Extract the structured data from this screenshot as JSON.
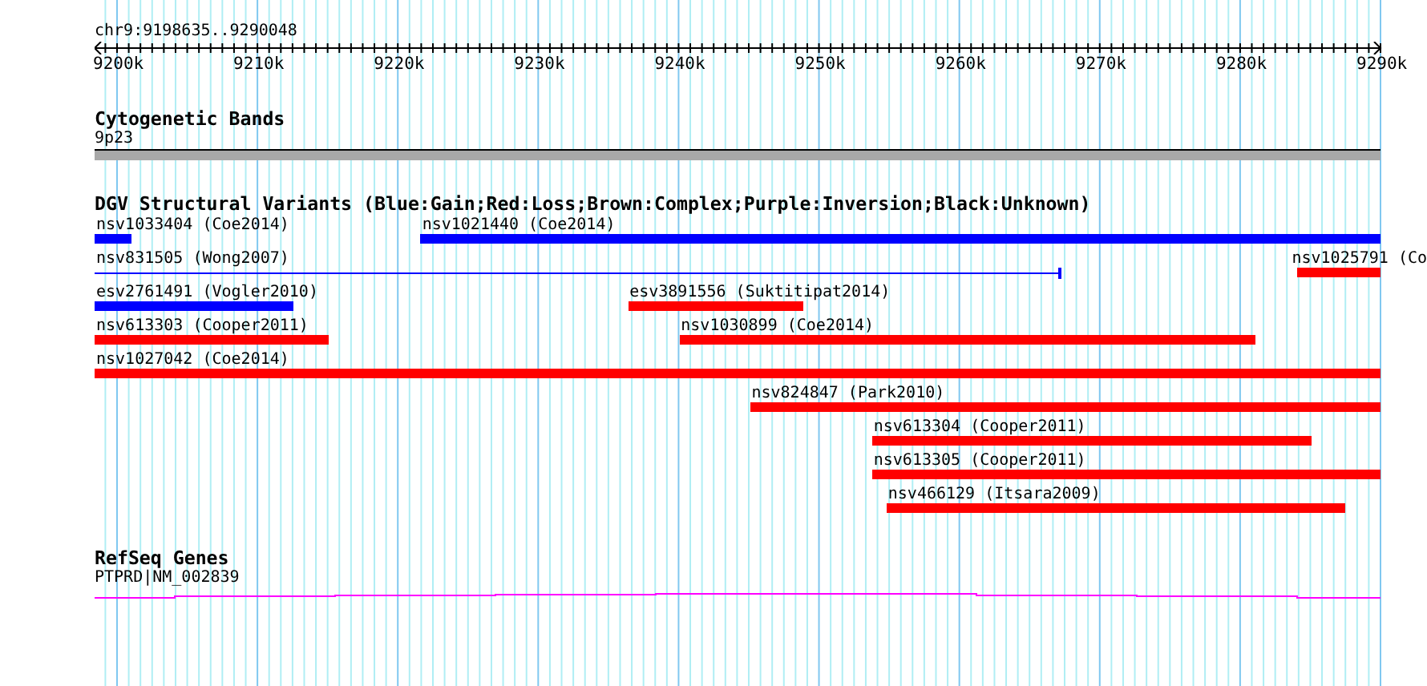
{
  "ruler": {
    "label": "chr9:9198635..9290048",
    "ticks": [
      "9200k",
      "9210k",
      "9220k",
      "9230k",
      "9240k",
      "9250k",
      "9260k",
      "9270k",
      "9280k",
      "9290k"
    ]
  },
  "cytogenetic_track": {
    "title": "Cytogenetic Bands",
    "band_label": "9p23"
  },
  "dgv_track": {
    "title": "DGV Structural Variants (Blue:Gain;Red:Loss;Brown:Complex;Purple:Inversion;Black:Unknown)",
    "rows": [
      {
        "features": [
          {
            "label": "nsv1033404 (Coe2014)",
            "kind": "bar",
            "color": "#0000ff"
          },
          {
            "label": "nsv1021440 (Coe2014)",
            "kind": "bar",
            "color": "#0000ff"
          }
        ]
      },
      {
        "features": [
          {
            "label": "nsv831505 (Wong2007)",
            "kind": "line",
            "color": "#0000ff"
          },
          {
            "label": "nsv1025791 (Co",
            "kind": "bar",
            "color": "#ff0000"
          }
        ]
      },
      {
        "features": [
          {
            "label": "esv2761491 (Vogler2010)",
            "kind": "bar",
            "color": "#0000ff"
          },
          {
            "label": "esv3891556 (Suktitipat2014)",
            "kind": "bar",
            "color": "#ff0000"
          }
        ]
      },
      {
        "features": [
          {
            "label": "nsv613303 (Cooper2011)",
            "kind": "bar",
            "color": "#ff0000"
          },
          {
            "label": "nsv1030899 (Coe2014)",
            "kind": "bar",
            "color": "#ff0000"
          }
        ]
      },
      {
        "features": [
          {
            "label": "nsv1027042 (Coe2014)",
            "kind": "bar",
            "color": "#ff0000"
          }
        ]
      },
      {
        "features": [
          {
            "label": "nsv824847 (Park2010)",
            "kind": "bar",
            "color": "#ff0000"
          }
        ]
      },
      {
        "features": [
          {
            "label": "nsv613304 (Cooper2011)",
            "kind": "bar",
            "color": "#ff0000"
          }
        ]
      },
      {
        "features": [
          {
            "label": "nsv613305 (Cooper2011)",
            "kind": "bar",
            "color": "#ff0000"
          }
        ]
      },
      {
        "features": [
          {
            "label": "nsv466129 (Itsara2009)",
            "kind": "bar",
            "color": "#ff0000"
          }
        ]
      }
    ]
  },
  "refseq_track": {
    "title": "RefSeq Genes",
    "gene_label": "PTPRD|NM_002839"
  }
}
